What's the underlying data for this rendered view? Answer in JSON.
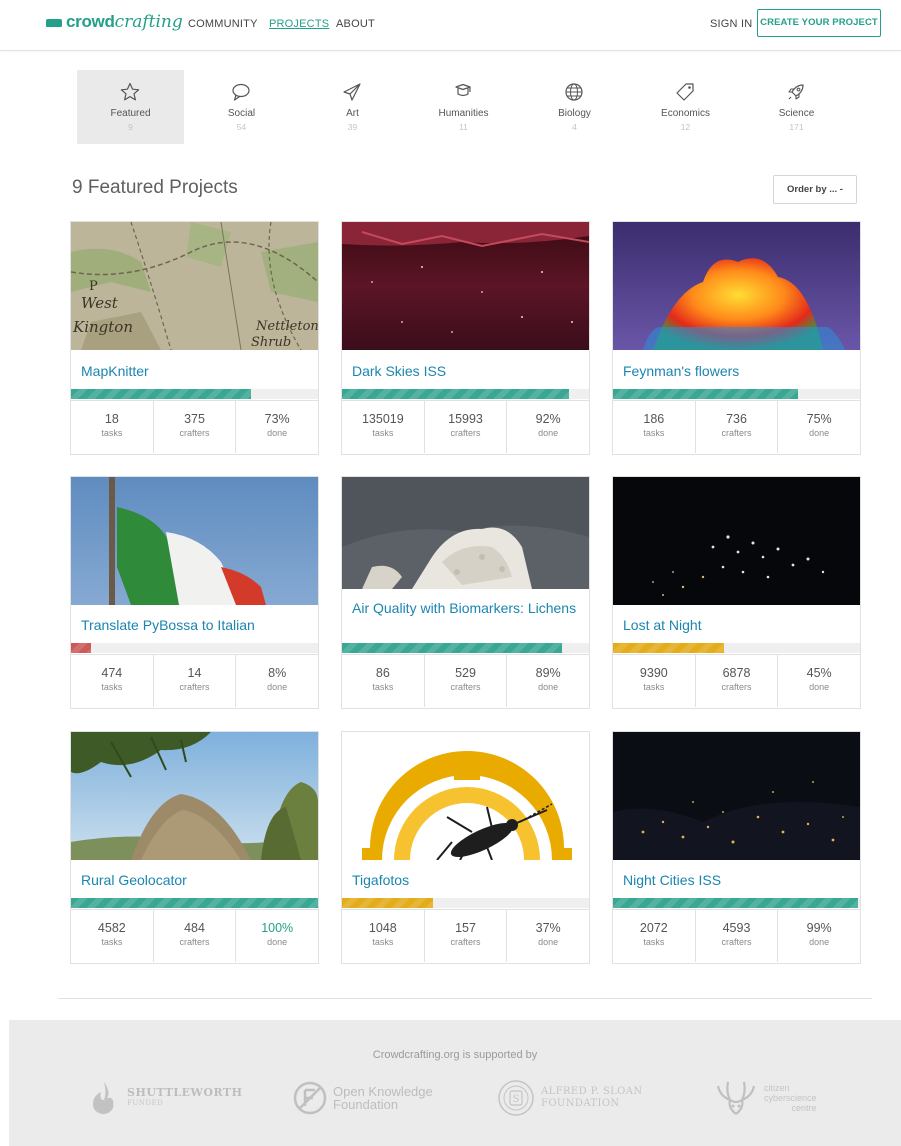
{
  "nav": {
    "logo_word1": "crowd",
    "logo_word2": "crafting",
    "links": [
      "COMMUNITY",
      "PROJECTS",
      "ABOUT"
    ],
    "sign_in": "SIGN IN",
    "create_project": "CREATE YOUR PROJECT"
  },
  "categories": [
    {
      "label": "Featured",
      "count": "9",
      "icon": "star-icon"
    },
    {
      "label": "Social",
      "count": "54",
      "icon": "speech-bubble-icon"
    },
    {
      "label": "Art",
      "count": "39",
      "icon": "paper-plane-icon"
    },
    {
      "label": "Humanities",
      "count": "11",
      "icon": "graduation-cap-icon"
    },
    {
      "label": "Biology",
      "count": "4",
      "icon": "globe-icon"
    },
    {
      "label": "Economics",
      "count": "12",
      "icon": "tag-icon"
    },
    {
      "label": "Science",
      "count": "171",
      "icon": "rocket-icon"
    }
  ],
  "heading": "9 Featured Projects",
  "order_by": "Order by ... -",
  "projects": [
    {
      "title": "MapKnitter",
      "tasks": "18",
      "crafters": "375",
      "done": "73%",
      "progress": 0.73,
      "tasks_label": "tasks",
      "crafters_label": "crafters",
      "done_label": "done",
      "bar_color": "#23a089"
    },
    {
      "title": "Dark Skies ISS",
      "tasks": "135019",
      "crafters": "15993",
      "done": "92%",
      "progress": 0.92,
      "tasks_label": "tasks",
      "crafters_label": "crafters",
      "done_label": "done",
      "bar_color": "#23a089"
    },
    {
      "title": "Feynman's flowers",
      "tasks": "186",
      "crafters": "736",
      "done": "75%",
      "progress": 0.75,
      "tasks_label": "tasks",
      "crafters_label": "crafters",
      "done_label": "done",
      "bar_color": "#23a089"
    },
    {
      "title": "Translate PyBossa to Italian",
      "tasks": "474",
      "crafters": "14",
      "done": "8%",
      "progress": 0.08,
      "tasks_label": "tasks",
      "crafters_label": "crafters",
      "done_label": "done",
      "bar_color": "#c9484a"
    },
    {
      "title": "Air Quality with Biomarkers: Lichens",
      "tasks": "86",
      "crafters": "529",
      "done": "89%",
      "progress": 0.89,
      "tasks_label": "tasks",
      "crafters_label": "crafters",
      "done_label": "done",
      "bar_color": "#23a089"
    },
    {
      "title": "Lost at Night",
      "tasks": "9390",
      "crafters": "6878",
      "done": "45%",
      "progress": 0.45,
      "tasks_label": "tasks",
      "crafters_label": "crafters",
      "done_label": "done",
      "bar_color": "#e3a500"
    },
    {
      "title": "Rural Geolocator",
      "tasks": "4582",
      "crafters": "484",
      "done": "100%",
      "progress": 1.0,
      "tasks_label": "tasks",
      "crafters_label": "crafters",
      "done_label": "done",
      "bar_color": "#23a089"
    },
    {
      "title": "Tigafotos",
      "tasks": "1048",
      "crafters": "157",
      "done": "37%",
      "progress": 0.37,
      "tasks_label": "tasks",
      "crafters_label": "crafters",
      "done_label": "done",
      "bar_color": "#e3a500"
    },
    {
      "title": "Night Cities ISS",
      "tasks": "2072",
      "crafters": "4593",
      "done": "99%",
      "progress": 0.99,
      "tasks_label": "tasks",
      "crafters_label": "crafters",
      "done_label": "done",
      "bar_color": "#23a089"
    }
  ],
  "footer": {
    "supported_by": "Crowdcrafting.org is supported by",
    "sponsors": [
      {
        "name": "SHUTTLEWORTH",
        "sub": "FUNDED"
      },
      {
        "name": "Open Knowledge",
        "sub": "Foundation"
      },
      {
        "name": "ALFRED P. SLOAN",
        "sub": "FOUNDATION"
      },
      {
        "name": "citizen",
        "sub": "cyberscience",
        "sub2": "centre"
      }
    ]
  }
}
